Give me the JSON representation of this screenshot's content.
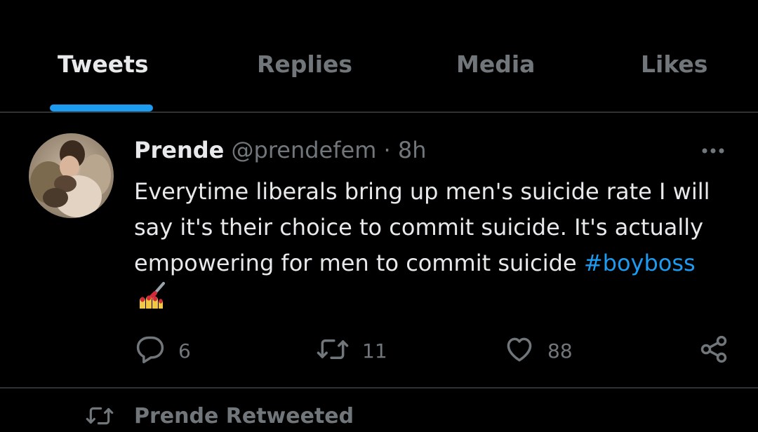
{
  "tabs": [
    {
      "label": "Tweets",
      "active": true
    },
    {
      "label": "Replies",
      "active": false
    },
    {
      "label": "Media",
      "active": false
    },
    {
      "label": "Likes",
      "active": false
    }
  ],
  "tweet": {
    "author_name": "Prende",
    "author_handle": "@prendefem",
    "separator": "·",
    "time": "8h",
    "text_lines": [
      "Everytime liberals bring up men's suicide rate I will",
      "say it's their choice to commit suicide. It's actually",
      "empowering for men to commit suicide "
    ],
    "hashtag": "#boyboss",
    "emoji": "💅",
    "stats": {
      "replies": "6",
      "retweets": "11",
      "likes": "88"
    },
    "icons": [
      "more-icon",
      "reply-icon",
      "retweet-icon",
      "like-icon",
      "share-icon"
    ]
  },
  "next_item": {
    "retweeted_label": "Prende Retweeted",
    "icon": "retweet-icon"
  },
  "colors": {
    "background": "#000000",
    "text": "#e7e9ea",
    "muted": "#71767b",
    "accent": "#1d9bf0",
    "divider": "#2f3336"
  }
}
